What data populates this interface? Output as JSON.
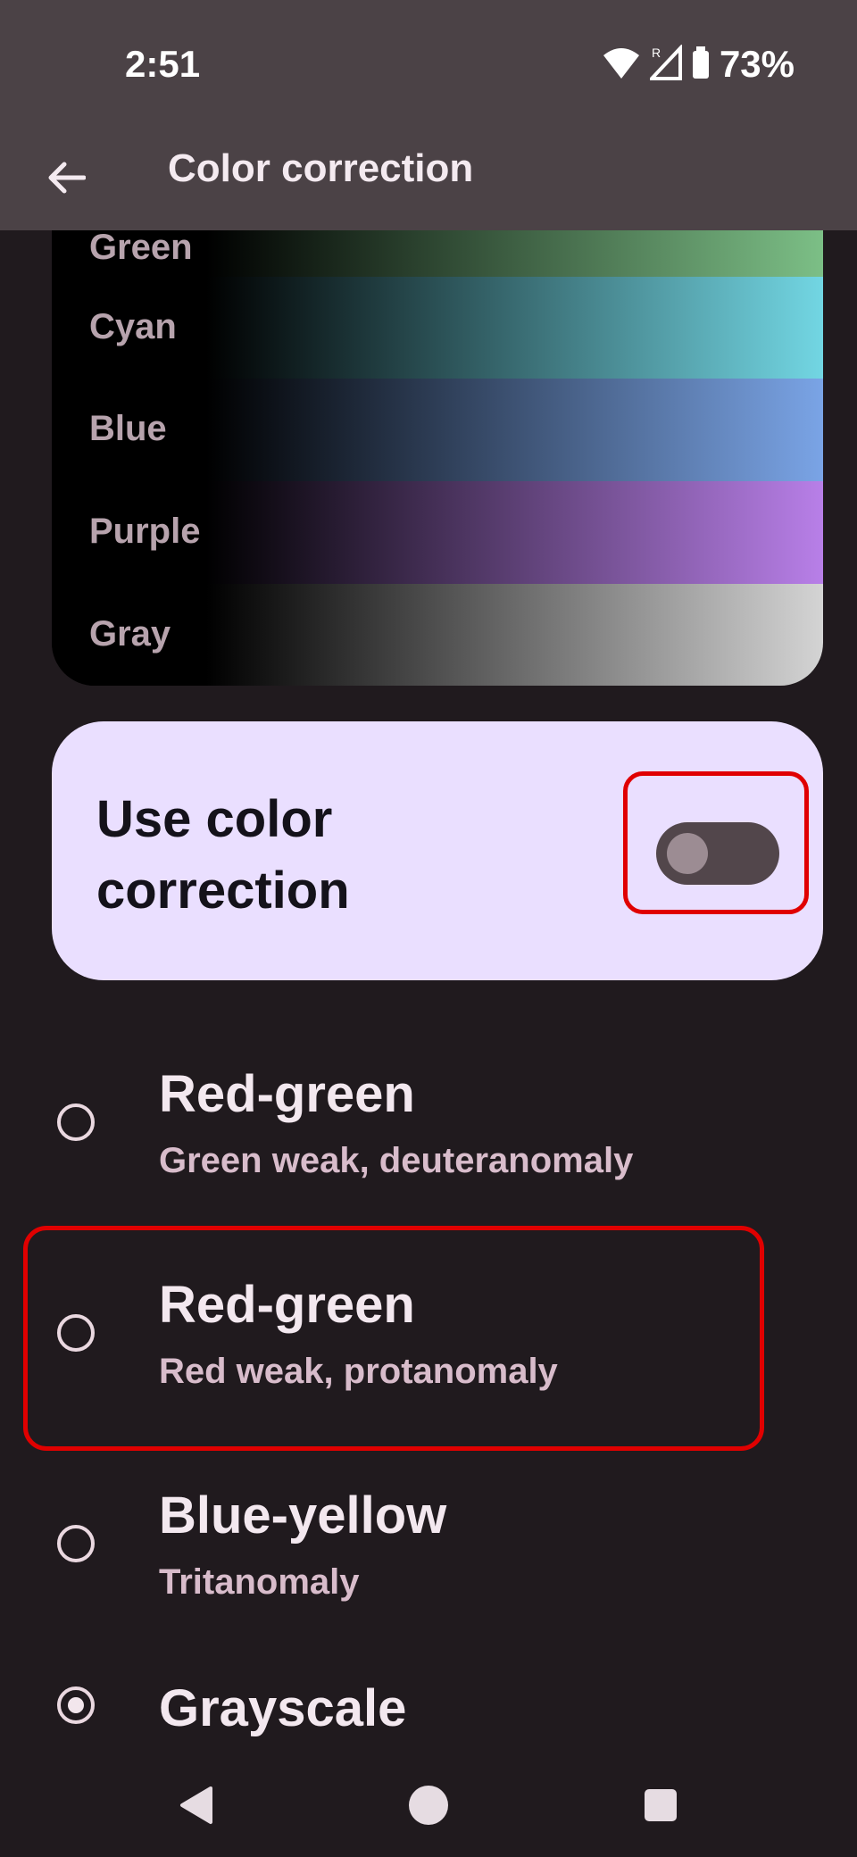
{
  "status": {
    "time": "2:51",
    "battery": "73%"
  },
  "app_bar": {
    "title": "Color correction"
  },
  "preview": {
    "bands": [
      {
        "label": "Green",
        "color": "#7cbf86"
      },
      {
        "label": "Cyan",
        "color": "#72d6e3"
      },
      {
        "label": "Blue",
        "color": "#7aa4e6"
      },
      {
        "label": "Purple",
        "color": "#b87fe8"
      },
      {
        "label": "Gray",
        "color": "#d4d4d4"
      }
    ]
  },
  "toggle": {
    "label": "Use color correction",
    "on": false
  },
  "options": [
    {
      "title": "Red-green",
      "subtitle": "Green weak, deuteranomaly",
      "selected": false
    },
    {
      "title": "Red-green",
      "subtitle": "Red weak, protanomaly",
      "selected": false
    },
    {
      "title": "Blue-yellow",
      "subtitle": "Tritanomaly",
      "selected": false
    },
    {
      "title": "Grayscale",
      "subtitle": "",
      "selected": true
    }
  ],
  "highlight_color": "#e00000"
}
